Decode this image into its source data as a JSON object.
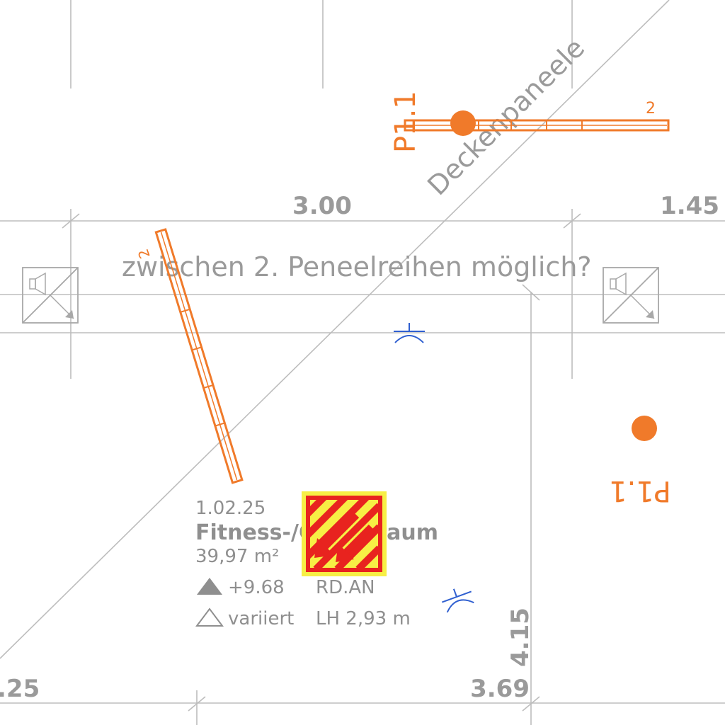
{
  "dimensions": {
    "top_center": "3.00",
    "top_right": "1.45",
    "bottom_left": ".25",
    "bottom_right": "3.69",
    "vertical_right": "4.15"
  },
  "annotations": {
    "ceiling_label": "Deckenpaneele",
    "question": "zwischen 2. Peneelreihen möglich?"
  },
  "panels": {
    "tag_top": "P1.1",
    "tag_right": "P1.1",
    "count_top": "2",
    "count_diagonal": "2"
  },
  "room": {
    "number": "1.02.25",
    "name": "Fitness-/Cardioraum",
    "area": "39,97 m²",
    "level_top": "+9.68",
    "level_bottom": "variiert",
    "ceiling_type": "RD.AN",
    "clear_height": "LH 2,93 m"
  },
  "colors": {
    "panel_orange": "#f07a2a",
    "grid_gray": "#bdbdbd",
    "text_gray": "#9a9a9a",
    "fixture_blue": "#2f5fd0",
    "exit_sign_red": "#e8231f",
    "exit_sign_yellow": "#f7ef45"
  },
  "symbols": [
    "speaker-outlet-icon",
    "speaker-outlet-icon",
    "downlight-icon",
    "downlight-icon",
    "emergency-exit-sign-icon",
    "panel-marker-dot"
  ]
}
